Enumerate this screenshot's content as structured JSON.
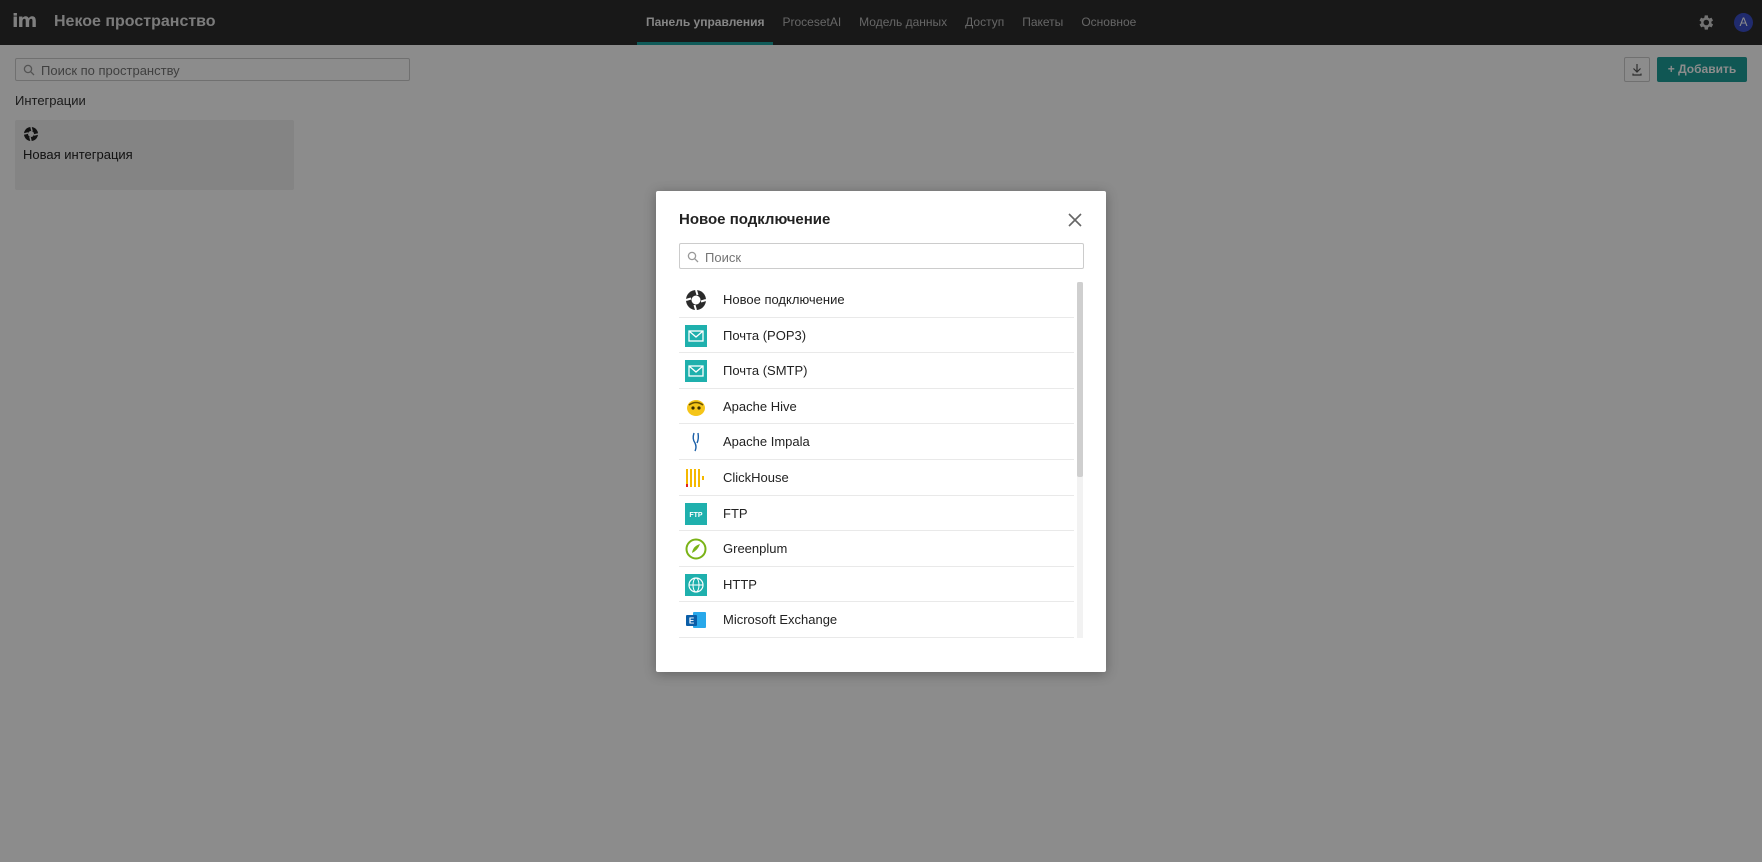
{
  "app": {
    "logo_text": "im",
    "workspace_title": "Некое пространство",
    "avatar_letter": "A",
    "nav_tabs": [
      {
        "label": "Панель управления",
        "active": true
      },
      {
        "label": "ProcesetAI",
        "active": false
      },
      {
        "label": "Модель данных",
        "active": false
      },
      {
        "label": "Доступ",
        "active": false
      },
      {
        "label": "Пакеты",
        "active": false
      },
      {
        "label": "Основное",
        "active": false
      }
    ]
  },
  "page": {
    "search_placeholder": "Поиск по пространству",
    "add_button_label": "+ Добавить",
    "section_title": "Интеграции",
    "integration_card_label": "Новая интеграция"
  },
  "modal": {
    "title": "Новое подключение",
    "search_placeholder": "Поиск",
    "items": [
      {
        "label": "Новое подключение",
        "icon": "connection-icon"
      },
      {
        "label": "Почта (POP3)",
        "icon": "mail-icon"
      },
      {
        "label": "Почта (SMTP)",
        "icon": "mail-icon"
      },
      {
        "label": "Apache Hive",
        "icon": "apache-hive-icon"
      },
      {
        "label": "Apache Impala",
        "icon": "apache-impala-icon"
      },
      {
        "label": "ClickHouse",
        "icon": "clickhouse-icon"
      },
      {
        "label": "FTP",
        "icon": "ftp-icon"
      },
      {
        "label": "Greenplum",
        "icon": "greenplum-icon"
      },
      {
        "label": "HTTP",
        "icon": "http-icon"
      },
      {
        "label": "Microsoft Exchange",
        "icon": "microsoft-exchange-icon"
      }
    ]
  },
  "colors": {
    "accent": "#1e9e99",
    "topbar": "#2c2c2c",
    "avatar": "#3b4fc9"
  }
}
